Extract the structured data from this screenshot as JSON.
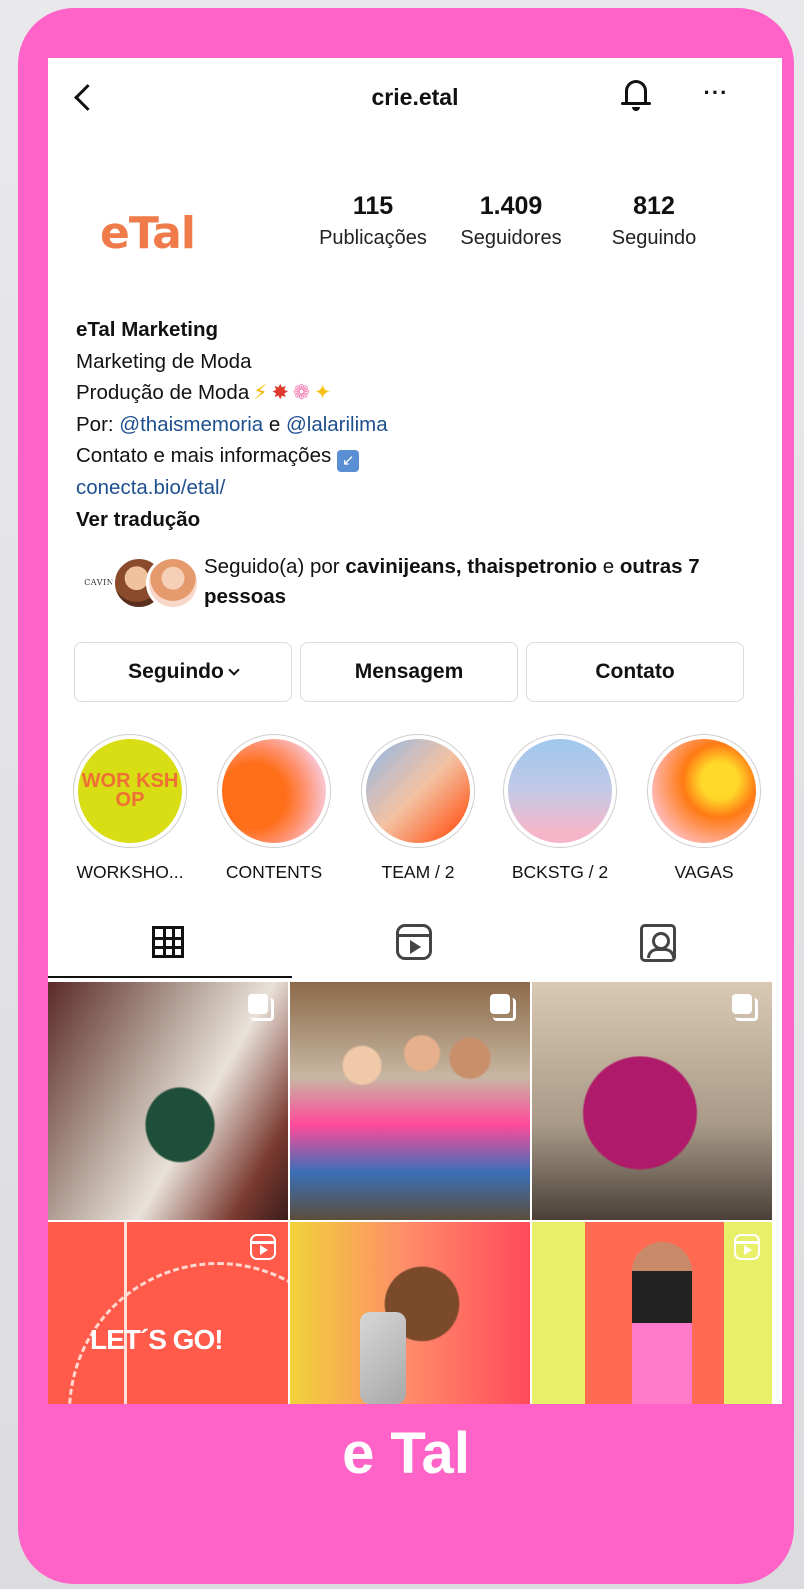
{
  "header": {
    "username": "crie.etal"
  },
  "profile": {
    "logo_text": "eTal",
    "stats": [
      {
        "value": "115",
        "label": "Publicações"
      },
      {
        "value": "1.409",
        "label": "Seguidores"
      },
      {
        "value": "812",
        "label": "Seguindo"
      }
    ],
    "bio": {
      "name": "eTal Marketing",
      "line1": "Marketing de Moda",
      "line2": "Produção de Moda",
      "line3_prefix": "Por: ",
      "mention1": "@thaismemoria",
      "line3_join": " e ",
      "mention2": "@lalarilima",
      "line4": "Contato e mais informações",
      "link": "conecta.bio/etal/",
      "translate": "Ver tradução"
    },
    "followed_by": {
      "prefix": "Seguido(a) por ",
      "users": "cavinijeans, thaispetronio",
      "join": " e ",
      "others": "outras 7 pessoas",
      "avatar1_text": "CAVINI"
    }
  },
  "actions": {
    "following_label": "Seguindo",
    "message_label": "Mensagem",
    "contact_label": "Contato"
  },
  "highlights": [
    {
      "label": "WORKSHO...",
      "cover_text": "WOR KSH OP"
    },
    {
      "label": "CONTENTS"
    },
    {
      "label": "TEAM / 2"
    },
    {
      "label": "BCKSTG / 2"
    },
    {
      "label": "VAGAS"
    }
  ],
  "tabs": [
    "grid-icon",
    "reels-icon",
    "tagged-icon"
  ],
  "posts": [
    {
      "type": "carousel"
    },
    {
      "type": "carousel"
    },
    {
      "type": "carousel"
    },
    {
      "type": "reel",
      "overlay_text": "LET´S GO!"
    },
    {
      "type": "photo"
    },
    {
      "type": "reel"
    }
  ],
  "caption": "e Tal",
  "colors": {
    "frame": "#ff63c8",
    "link": "#1e4f8f",
    "logo": "#ef7b4a"
  }
}
